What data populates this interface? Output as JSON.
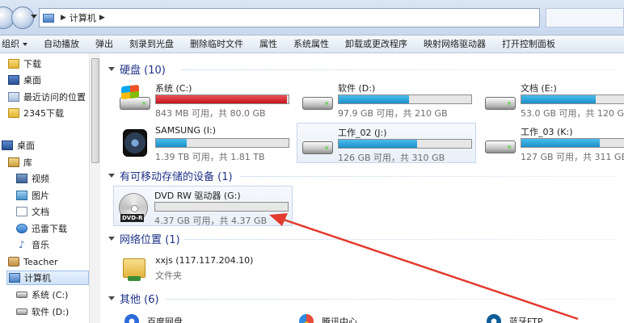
{
  "address": {
    "path": "计算机"
  },
  "toolbar": {
    "items": [
      "组织",
      "自动播放",
      "弹出",
      "刻录到光盘",
      "删除临时文件",
      "属性",
      "系统属性",
      "卸载或更改程序",
      "映射网络驱动器",
      "打开控制面板"
    ]
  },
  "sidebar": {
    "items": [
      {
        "label": "下载",
        "icon": "folder-icon"
      },
      {
        "label": "桌面",
        "icon": "desktop-icon"
      },
      {
        "label": "最近访问的位置",
        "icon": "recent-places-icon"
      },
      {
        "label": "2345下载",
        "icon": "folder-icon"
      },
      {
        "label": "桌面",
        "icon": "desktop-icon"
      },
      {
        "label": "库",
        "icon": "library-icon"
      },
      {
        "label": "视频",
        "icon": "video-library-icon"
      },
      {
        "label": "图片",
        "icon": "pictures-library-icon"
      },
      {
        "label": "文档",
        "icon": "documents-library-icon"
      },
      {
        "label": "迅雷下载",
        "icon": "xunlei-icon"
      },
      {
        "label": "音乐",
        "icon": "music-icon"
      },
      {
        "label": "Teacher",
        "icon": "user-folder-icon"
      },
      {
        "label": "计算机",
        "icon": "computer-icon"
      },
      {
        "label": "系统 (C:)",
        "icon": "drive-icon"
      },
      {
        "label": "软件 (D:)",
        "icon": "drive-icon"
      }
    ]
  },
  "groups": {
    "hdd": "硬盘 (10)",
    "removable": "有可移动存储的设备 (1)",
    "network": "网络位置 (1)",
    "other": "其他 (6)"
  },
  "drives": [
    {
      "name": "系统 (C:)",
      "free": "843 MB 可用，共 80.0 GB",
      "used_fraction": 0.99,
      "bar_color": "#d51c24"
    },
    {
      "name": "软件 (D:)",
      "free": "97.9 GB 可用，共 210 GB",
      "used_fraction": 0.53,
      "bar_color": "#26a0da"
    },
    {
      "name": "文档 (E:)",
      "free": "53.0 GB 可用，共 120 GB",
      "used_fraction": 0.56,
      "bar_color": "#26a0da"
    },
    {
      "name": "SAMSUNG (I:)",
      "free": "1.39 TB 可用，共 1.81 TB",
      "used_fraction": 0.23,
      "bar_color": "#26a0da"
    },
    {
      "name": "工作_02 (J:)",
      "free": "126 GB 可用，共 310 GB",
      "used_fraction": 0.59,
      "bar_color": "#26a0da"
    },
    {
      "name": "工作_03 (K:)",
      "free": "127 GB 可用，共 311 GB",
      "used_fraction": 0.59,
      "bar_color": "#26a0da"
    }
  ],
  "dvd": {
    "name": "DVD RW 驱动器 (G:)",
    "free": "4.37 GB 可用，共 4.37 GB",
    "used_fraction": 0.0
  },
  "network": {
    "name": "xxjs (117.117.204.10)",
    "type": "文件夹"
  },
  "other": [
    {
      "name": "百度网盘"
    },
    {
      "name": "腾讯中心"
    },
    {
      "name": "蓝牙FTP"
    }
  ]
}
